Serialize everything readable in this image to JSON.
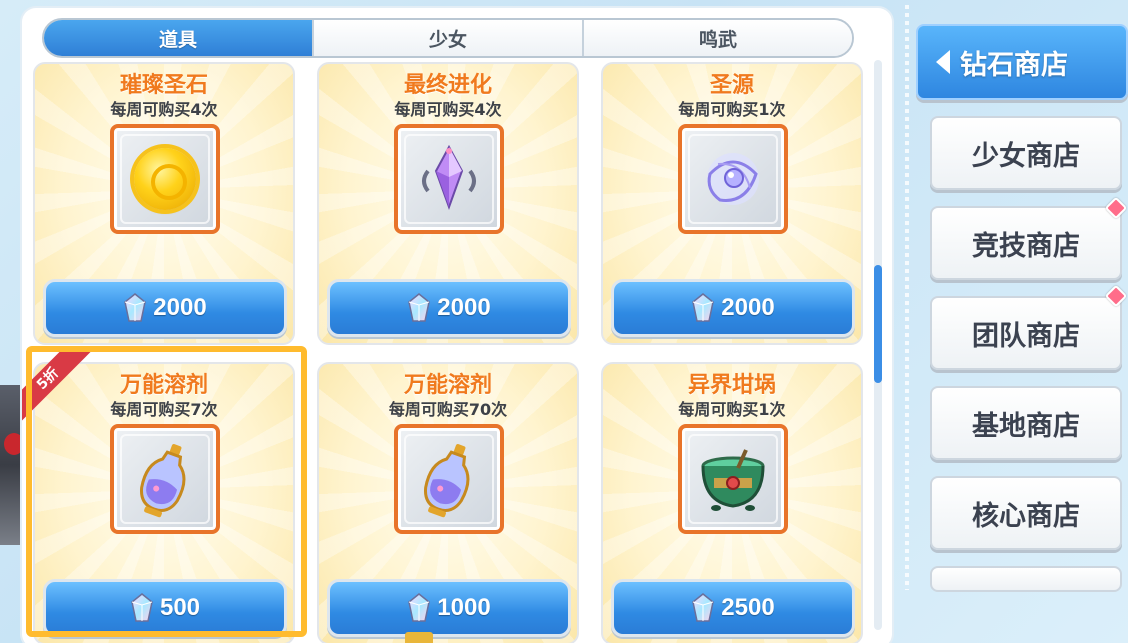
{
  "tabs": [
    "道具",
    "少女",
    "鸣武"
  ],
  "active_tab": 0,
  "currency_icon": "gem-icon",
  "items": [
    {
      "name": "璀璨圣石",
      "limit": "每周可购买4次",
      "price": "2000",
      "icon": "gold-orb-icon"
    },
    {
      "name": "最终进化",
      "limit": "每周可购买4次",
      "price": "2000",
      "icon": "purple-crystal-icon"
    },
    {
      "name": "圣源",
      "limit": "每周可购买1次",
      "price": "2000",
      "icon": "spirit-orb-icon"
    },
    {
      "name": "万能溶剂",
      "limit": "每周可购买7次",
      "price": "500",
      "icon": "potion-bottle-icon",
      "discount": "5折"
    },
    {
      "name": "万能溶剂",
      "limit": "每周可购买70次",
      "price": "1000",
      "icon": "potion-bottle-icon"
    },
    {
      "name": "异界坩埚",
      "limit": "每周可购买1次",
      "price": "2500",
      "icon": "cauldron-icon"
    }
  ],
  "sidebar": {
    "active": "钻石商店",
    "items": [
      "少女商店",
      "竞技商店",
      "团队商店",
      "基地商店",
      "核心商店"
    ]
  },
  "colors": {
    "accent_blue": "#2f8ae3",
    "item_name_orange": "#f07a1e",
    "highlight_gold": "#ffbb2e",
    "discount_red": "#d93a45"
  }
}
